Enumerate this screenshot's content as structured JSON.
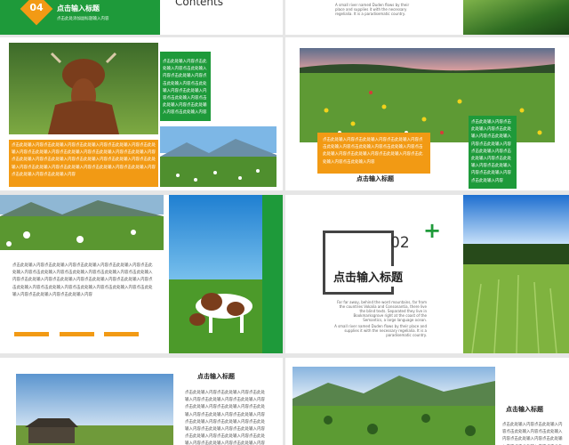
{
  "colors": {
    "green": "#1e9a3a",
    "orange": "#f29a14",
    "bg": "#e6e6e6"
  },
  "slide1": {
    "badge": "04",
    "title": "点击输入标题",
    "subtitle": "点击此处添加副标题输入内容"
  },
  "slide2": {
    "title": "Contents"
  },
  "slide3": {
    "en_text": "A small river named Duden flows by their place and supplies it with the necessary regelialia. It is a paradisematic country."
  },
  "lorem_short": "点击此处输入内容点击此处输入内容点击此处输入内容点击此处输入内容点击此处输入内容点击此处输入内容点击此处输入内容点击此处输入内容点击此处输入内容点击此处输入内容点击此处输入内容",
  "lorem_long": "点击此处输入内容点击此处输入内容点击此处输入内容点击此处输入内容点击此处输入内容点击此处输入内容点击此处输入内容点击此处输入内容点击此处输入内容点击此处输入内容点击此处输入内容点击此处输入内容点击此处输入内容点击此处输入内容点击此处输入内容点击此处输入内容点击此处输入内容点击此处输入内容点击此处输入内容点击此处输入内容",
  "slide5": {
    "title": "点击输入标题"
  },
  "slide7": {
    "number": "02",
    "plus": "+",
    "title": "点击输入标题",
    "en_text1": "Far far away, behind the word mountains, far from the countries Vokalia and Consonantia, there live the blind texts. Separated they live in Bookmarksgrove right at the coast of the Semantics, a large language ocean.",
    "en_text2": "A small river named Duden flows by their place and supplies it with the necessary regelialia. It is a paradisematic country."
  },
  "slide9": {
    "title": "点击输入标题"
  },
  "slide10": {
    "title": "点击输入标题"
  }
}
